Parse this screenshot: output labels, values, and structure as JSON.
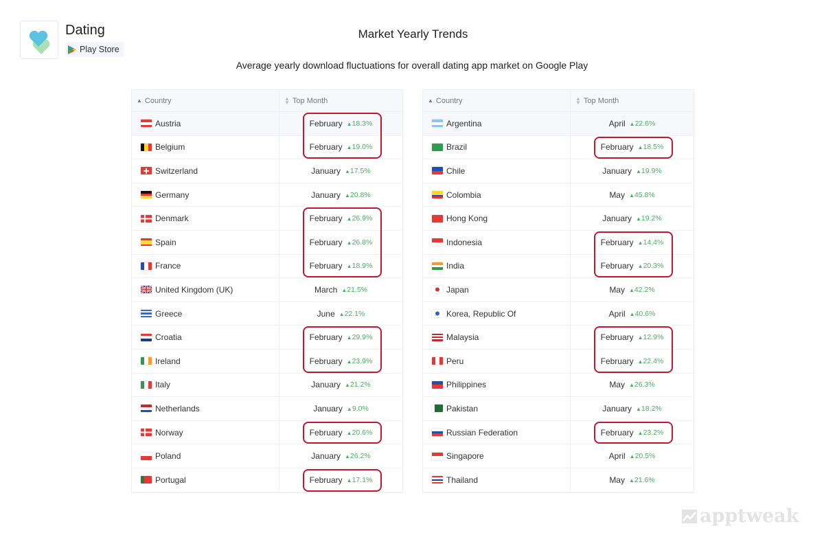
{
  "app": {
    "title": "Dating",
    "store": "Play Store"
  },
  "header": {
    "title": "Market Yearly Trends",
    "subtitle": "Average yearly download fluctuations for overall dating app market on Google Play"
  },
  "columns": {
    "country": "Country",
    "top_month": "Top Month"
  },
  "colors": {
    "highlight": "#c0182c",
    "increase": "#4caf63"
  },
  "tables": [
    {
      "rows": [
        {
          "country": "Austria",
          "month": "February",
          "change": "18.3%",
          "highlighted": true
        },
        {
          "country": "Belgium",
          "month": "February",
          "change": "19.0%",
          "highlighted": true
        },
        {
          "country": "Switzerland",
          "month": "January",
          "change": "17.5%"
        },
        {
          "country": "Germany",
          "month": "January",
          "change": "20.8%"
        },
        {
          "country": "Denmark",
          "month": "February",
          "change": "26.9%",
          "highlighted": true
        },
        {
          "country": "Spain",
          "month": "February",
          "change": "26.8%",
          "highlighted": true
        },
        {
          "country": "France",
          "month": "February",
          "change": "18.9%",
          "highlighted": true
        },
        {
          "country": "United Kingdom (UK)",
          "month": "March",
          "change": "21.5%"
        },
        {
          "country": "Greece",
          "month": "June",
          "change": "22.1%"
        },
        {
          "country": "Croatia",
          "month": "February",
          "change": "29.9%",
          "highlighted": true
        },
        {
          "country": "Ireland",
          "month": "February",
          "change": "23.9%",
          "highlighted": true
        },
        {
          "country": "Italy",
          "month": "January",
          "change": "21.2%"
        },
        {
          "country": "Netherlands",
          "month": "January",
          "change": "9.0%"
        },
        {
          "country": "Norway",
          "month": "February",
          "change": "20.6%",
          "highlighted": true,
          "break": true
        },
        {
          "country": "Poland",
          "month": "January",
          "change": "26.2%"
        },
        {
          "country": "Portugal",
          "month": "February",
          "change": "17.1%",
          "highlighted": true
        }
      ]
    },
    {
      "rows": [
        {
          "country": "Argentina",
          "month": "April",
          "change": "22.6%"
        },
        {
          "country": "Brazil",
          "month": "February",
          "change": "18.5%",
          "highlighted": true
        },
        {
          "country": "Chile",
          "month": "January",
          "change": "19.9%"
        },
        {
          "country": "Colombia",
          "month": "May",
          "change": "45.8%"
        },
        {
          "country": "Hong Kong",
          "month": "January",
          "change": "19.2%"
        },
        {
          "country": "Indonesia",
          "month": "February",
          "change": "14.4%",
          "highlighted": true
        },
        {
          "country": "India",
          "month": "February",
          "change": "20.3%",
          "highlighted": true
        },
        {
          "country": "Japan",
          "month": "May",
          "change": "42.2%"
        },
        {
          "country": "Korea, Republic Of",
          "month": "April",
          "change": "40.6%"
        },
        {
          "country": "Malaysia",
          "month": "February",
          "change": "12.9%",
          "highlighted": true
        },
        {
          "country": "Peru",
          "month": "February",
          "change": "22.4%",
          "highlighted": true
        },
        {
          "country": "Philippines",
          "month": "May",
          "change": "26.3%"
        },
        {
          "country": "Pakistan",
          "month": "January",
          "change": "18.2%"
        },
        {
          "country": "Russian Federation",
          "month": "February",
          "change": "23.2%",
          "highlighted": true
        },
        {
          "country": "Singapore",
          "month": "April",
          "change": "20.5%"
        },
        {
          "country": "Thailand",
          "month": "May",
          "change": "21.6%"
        }
      ]
    }
  ],
  "watermark": "apptweak"
}
